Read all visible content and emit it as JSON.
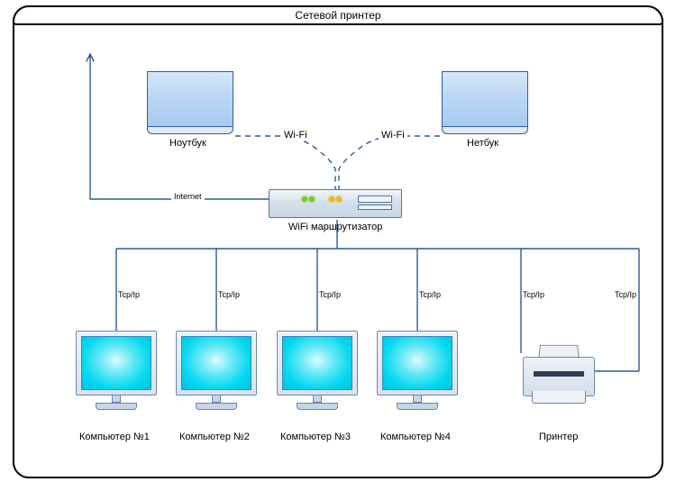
{
  "title": "Сетевой принтер",
  "top": {
    "notebook_label": "Ноутбук",
    "netbook_label": "Нетбук",
    "wifi_label_left": "Wi-Fi",
    "wifi_label_right": "Wi-Fi"
  },
  "internet_label": "Internet",
  "router_label": "WiFi маршрутизатор",
  "lan": {
    "proto_label": "Tcp/Ip",
    "devices": [
      {
        "label": "Компьютер №1"
      },
      {
        "label": "Компьютер №2"
      },
      {
        "label": "Компьютер №3"
      },
      {
        "label": "Компьютер №4"
      },
      {
        "label": "Принтер"
      }
    ]
  },
  "colors": {
    "wire": "#2a5a99",
    "wire_dash": "#2a5a99",
    "notebook_fill": "#b9d6f4",
    "monitor_fill": "#00d8f0"
  }
}
